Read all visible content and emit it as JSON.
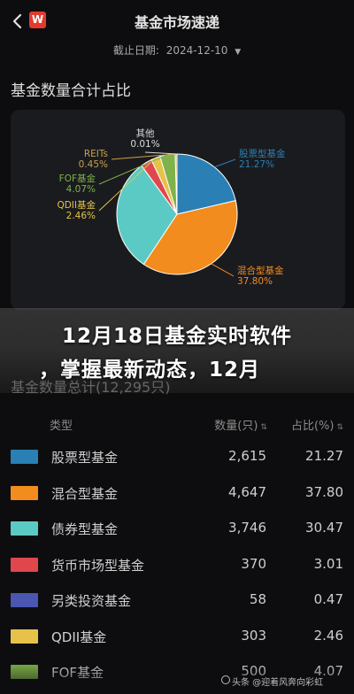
{
  "header": {
    "title": "基金市场速递",
    "logo_text": "W"
  },
  "date_filter": {
    "label": "截止日期:",
    "value": "2024-12-10",
    "dropdown_icon": "triangle-down-icon"
  },
  "section_title": "基金数量合计占比",
  "banner": {
    "line1": "12月18日基金实时软件",
    "line2": "，掌握最新动态，12月"
  },
  "total_title": "基金数量总计(12,295只)",
  "table": {
    "headers": {
      "type": "类型",
      "count": "数量(只)",
      "pct": "占比(%)"
    },
    "rows": [
      {
        "name": "股票型基金",
        "count": "2,615",
        "pct": "21.27",
        "color": "#2a7fb5"
      },
      {
        "name": "混合型基金",
        "count": "4,647",
        "pct": "37.80",
        "color": "#f28c1e"
      },
      {
        "name": "债券型基金",
        "count": "3,746",
        "pct": "30.47",
        "color": "#5ccac4"
      },
      {
        "name": "货币市场型基金",
        "count": "370",
        "pct": "3.01",
        "color": "#e0474c"
      },
      {
        "name": "另类投资基金",
        "count": "58",
        "pct": "0.47",
        "color": "#4a56b0"
      },
      {
        "name": "QDII基金",
        "count": "303",
        "pct": "2.46",
        "color": "#e6c24a"
      },
      {
        "name": "FOF基金",
        "count": "500",
        "pct": "4.07",
        "color": "#7fb24a"
      }
    ]
  },
  "chart_data": {
    "type": "pie",
    "title": "基金数量合计占比",
    "slices": [
      {
        "name": "股票型基金",
        "value": 21.27,
        "label": "21.27%",
        "color": "#2a7fb5"
      },
      {
        "name": "混合型基金",
        "value": 37.8,
        "label": "37.80%",
        "color": "#f28c1e"
      },
      {
        "name": "债券型基金",
        "value": 30.47,
        "label": "",
        "color": "#5ccac4"
      },
      {
        "name": "货币市场型基金",
        "value": 3.01,
        "label": "",
        "color": "#e0474c"
      },
      {
        "name": "QDII基金",
        "value": 2.46,
        "label": "2.46%",
        "color": "#e6c24a"
      },
      {
        "name": "FOF基金",
        "value": 4.07,
        "label": "4.07%",
        "color": "#7fb24a"
      },
      {
        "name": "REITs",
        "value": 0.45,
        "label": "0.45%",
        "color": "#c9a24a"
      },
      {
        "name": "其他",
        "value": 0.01,
        "label": "0.01%",
        "color": "#dcdcdc"
      }
    ]
  },
  "watermark": "头条 @迎着风奔向彩虹"
}
